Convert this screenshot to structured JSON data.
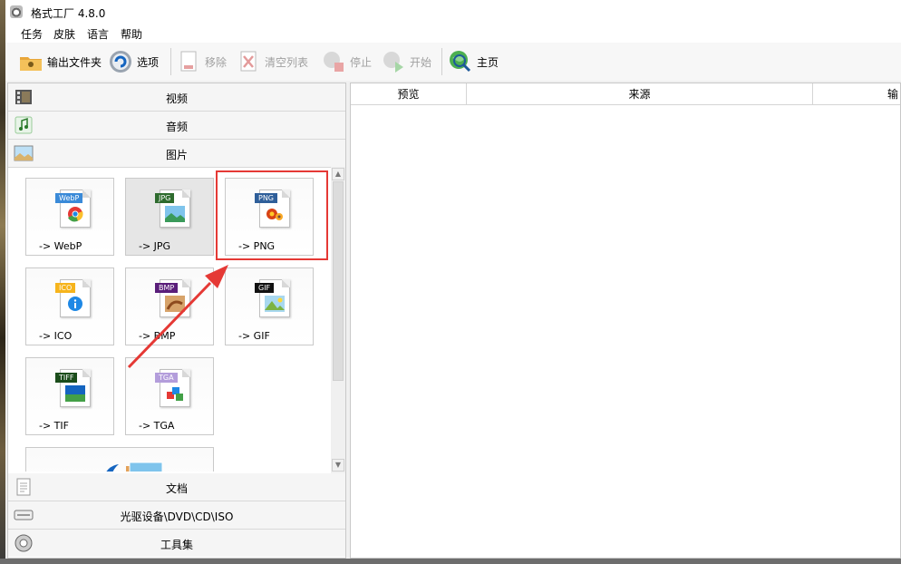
{
  "window": {
    "title": "格式工厂 4.8.0"
  },
  "menu": [
    "任务",
    "皮肤",
    "语言",
    "帮助"
  ],
  "toolbar": {
    "output_folder": "输出文件夹",
    "options": "选项",
    "remove": "移除",
    "clear_list": "清空列表",
    "stop": "停止",
    "start": "开始",
    "home": "主页"
  },
  "categories": {
    "video": "视频",
    "audio": "音频",
    "image": "图片",
    "document": "文档",
    "optical": "光驱设备\\DVD\\CD\\ISO",
    "tools": "工具集"
  },
  "tiles": [
    {
      "label": "-> WebP",
      "tag": "WebP"
    },
    {
      "label": "-> JPG",
      "tag": "JPG"
    },
    {
      "label": "-> PNG",
      "tag": "PNG"
    },
    {
      "label": "-> ICO",
      "tag": "ICO"
    },
    {
      "label": "-> BMP",
      "tag": "BMP"
    },
    {
      "label": "-> GIF",
      "tag": "GIF"
    },
    {
      "label": "-> TIF",
      "tag": "TIFF"
    },
    {
      "label": "-> TGA",
      "tag": "TGA"
    }
  ],
  "task_list": {
    "columns": [
      "预览",
      "来源",
      "输"
    ]
  },
  "colors": {
    "highlight": "#e53935",
    "toolbar_bg": "#f7f7f7"
  }
}
